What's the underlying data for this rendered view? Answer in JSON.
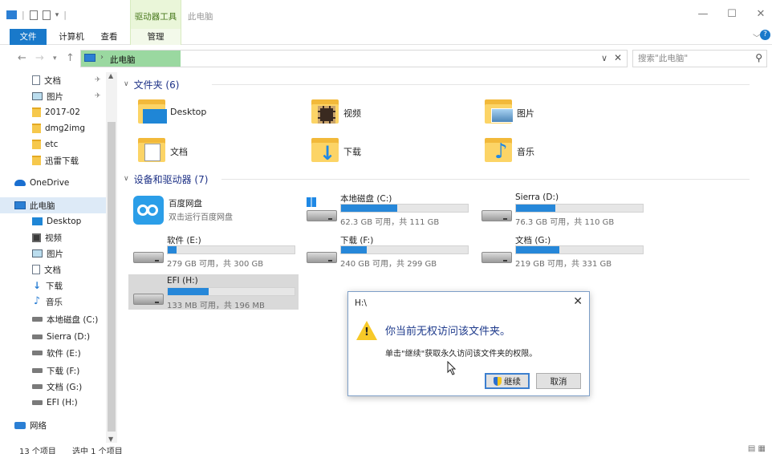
{
  "window": {
    "context_tab": "驱动器工具",
    "title": "此电脑",
    "min_icon": "minimize-icon",
    "max_icon": "maximize-icon",
    "close_icon": "close-icon"
  },
  "ribbon": {
    "tabs": [
      {
        "label": "文件"
      },
      {
        "label": "计算机"
      },
      {
        "label": "查看"
      },
      {
        "label": "管理"
      }
    ]
  },
  "nav": {
    "breadcrumb": "此电脑",
    "search_placeholder": "搜索\"此电脑\""
  },
  "sidebar": {
    "items": [
      {
        "label": "文档",
        "icon": "document-icon",
        "pinned": true
      },
      {
        "label": "图片",
        "icon": "pictures-icon",
        "pinned": true
      },
      {
        "label": "2017-02",
        "icon": "folder-icon"
      },
      {
        "label": "dmg2img",
        "icon": "folder-icon"
      },
      {
        "label": "etc",
        "icon": "folder-icon"
      },
      {
        "label": "迅雷下载",
        "icon": "folder-icon"
      },
      {
        "label": "OneDrive",
        "icon": "onedrive-icon"
      },
      {
        "label": "此电脑",
        "icon": "this-pc-icon",
        "selected": true
      },
      {
        "label": "Desktop",
        "icon": "desktop-icon"
      },
      {
        "label": "视频",
        "icon": "video-icon"
      },
      {
        "label": "图片",
        "icon": "pictures-icon"
      },
      {
        "label": "文档",
        "icon": "document-icon"
      },
      {
        "label": "下载",
        "icon": "download-icon"
      },
      {
        "label": "音乐",
        "icon": "music-icon"
      },
      {
        "label": "本地磁盘 (C:)",
        "icon": "drive-icon"
      },
      {
        "label": "Sierra (D:)",
        "icon": "drive-icon"
      },
      {
        "label": "软件 (E:)",
        "icon": "drive-icon"
      },
      {
        "label": "下载 (F:)",
        "icon": "drive-icon"
      },
      {
        "label": "文档 (G:)",
        "icon": "drive-icon"
      },
      {
        "label": "EFI (H:)",
        "icon": "drive-icon"
      },
      {
        "label": "网络",
        "icon": "network-icon"
      }
    ]
  },
  "folders": {
    "header": "文件夹 (6)",
    "items": [
      {
        "label": "Desktop",
        "icon": "desktop-folder-icon"
      },
      {
        "label": "视频",
        "icon": "video-folder-icon"
      },
      {
        "label": "图片",
        "icon": "pictures-folder-icon"
      },
      {
        "label": "文档",
        "icon": "documents-folder-icon"
      },
      {
        "label": "下载",
        "icon": "downloads-folder-icon"
      },
      {
        "label": "音乐",
        "icon": "music-folder-icon"
      }
    ]
  },
  "devices": {
    "header": "设备和驱动器 (7)",
    "baidu": {
      "name": "百度网盘",
      "sub": "双击运行百度网盘"
    },
    "drives": [
      {
        "name": "本地磁盘 (C:)",
        "free": "62.3 GB 可用，共 111 GB",
        "used_fraction": 0.44
      },
      {
        "name": "Sierra (D:)",
        "free": "76.3 GB 可用，共 110 GB",
        "used_fraction": 0.31
      },
      {
        "name": "软件 (E:)",
        "free": "279 GB 可用，共 300 GB",
        "used_fraction": 0.07
      },
      {
        "name": "下载 (F:)",
        "free": "240 GB 可用，共 299 GB",
        "used_fraction": 0.2
      },
      {
        "name": "文档 (G:)",
        "free": "219 GB 可用，共 331 GB",
        "used_fraction": 0.34
      },
      {
        "name": "EFI (H:)",
        "free": "133 MB 可用，共 196 MB",
        "used_fraction": 0.32
      }
    ]
  },
  "dialog": {
    "title": "H:\\",
    "message": "你当前无权访问该文件夹。",
    "detail": "单击\"继续\"获取永久访问该文件夹的权限。",
    "continue_label": "继续",
    "cancel_label": "取消"
  },
  "status": {
    "count": "13 个项目",
    "selected": "选中 1 个项目"
  }
}
